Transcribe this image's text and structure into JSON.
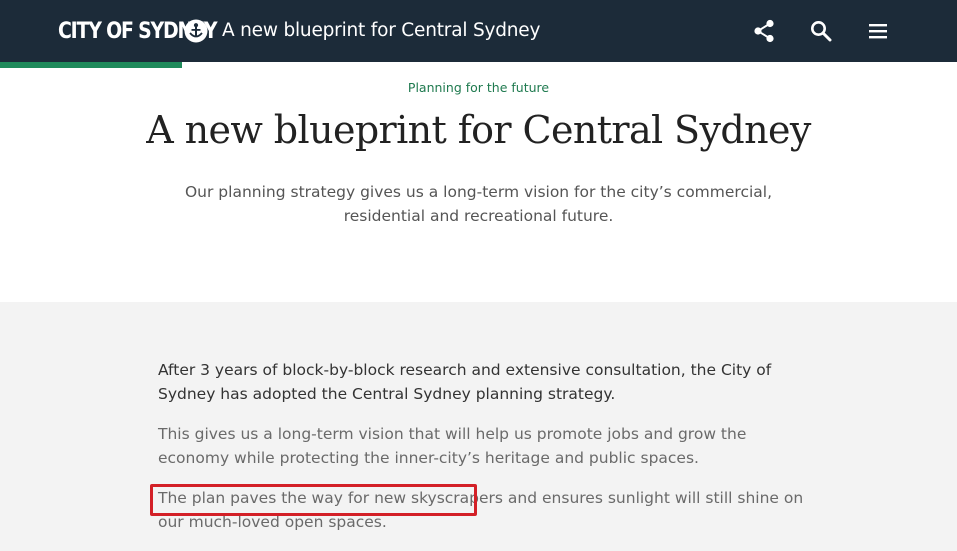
{
  "header": {
    "logo_text": "CITY OF SYDNEY",
    "title": "A new blueprint for Central Sydney",
    "icons": [
      "share-icon",
      "search-icon",
      "menu-icon"
    ],
    "background": "#1c2b39"
  },
  "progress": {
    "value": 0.19,
    "color": "#1f8a5b"
  },
  "hero": {
    "eyebrow": "Planning for the future",
    "title": "A new blueprint for Central Sydney",
    "subtitle": "Our planning strategy gives us a long-term vision for the city’s commercial, residential and recreational future."
  },
  "article": {
    "lead": "After 3 years of block-by-block research and extensive consultation, the City of Sydney has adopted the Central Sydney planning strategy.",
    "paragraph1": "This gives us a long-term vision that will help us promote jobs and grow the economy while protecting the inner-city’s heritage and public spaces.",
    "paragraph2": "The plan paves the way for new skyscrapers and ensures sunlight will still shine on our much-loved open spaces.",
    "highlight_color": "#d32027"
  }
}
